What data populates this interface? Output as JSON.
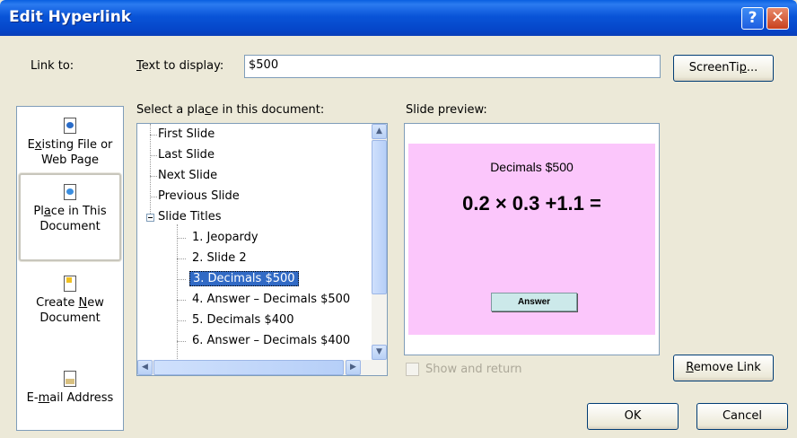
{
  "window": {
    "title": "Edit Hyperlink",
    "help_glyph": "?",
    "close_glyph": "✕"
  },
  "link_to_label": "Link to:",
  "text_to_display": {
    "label_u": "T",
    "label_rest": "ext to display:",
    "value": "$500"
  },
  "screentip_button": {
    "pre": "ScreenTi",
    "u": "p",
    "post": "..."
  },
  "sidebar": {
    "items": [
      {
        "line1_u": "x",
        "line1_pre": "E",
        "line1_post": "isting File or",
        "line2": "Web Page",
        "icon": "existing-file-icon"
      },
      {
        "line1_pre": "Pl",
        "line1_u": "a",
        "line1_post": "ce in This",
        "line2": "Document",
        "icon": "place-in-document-icon",
        "selected": true
      },
      {
        "line1_pre": "Create ",
        "line1_u": "N",
        "line1_post": "ew",
        "line2": "Document",
        "icon": "new-document-icon"
      },
      {
        "line1_pre": "E-",
        "line1_u": "m",
        "line1_post": "ail Address",
        "line2": "",
        "icon": "email-icon"
      }
    ]
  },
  "place_label": {
    "pre": "Select a pla",
    "u": "c",
    "post": "e in this document:"
  },
  "tree": {
    "items": [
      {
        "label": "First Slide",
        "level": 0
      },
      {
        "label": "Last Slide",
        "level": 0
      },
      {
        "label": "Next Slide",
        "level": 0
      },
      {
        "label": "Previous Slide",
        "level": 0
      },
      {
        "label": "Slide Titles",
        "level": 0,
        "expanded": true
      },
      {
        "label": "1. Jeopardy",
        "level": 1
      },
      {
        "label": "2. Slide 2",
        "level": 1
      },
      {
        "label": "3. Decimals $500",
        "level": 1,
        "selected": true
      },
      {
        "label": "4. Answer – Decimals $500",
        "level": 1
      },
      {
        "label": "5. Decimals $400",
        "level": 1
      },
      {
        "label": "6. Answer – Decimals $400",
        "level": 1
      }
    ]
  },
  "scroll_glyphs": {
    "up": "▲",
    "down": "▼",
    "left": "◀",
    "right": "▶"
  },
  "preview": {
    "label": "Slide preview:",
    "slide_title": "Decimals $500",
    "equation": "0.2 × 0.3 +1.1 =",
    "answer_button": "Answer",
    "background_color": "#fbc6fb"
  },
  "show_and_return": {
    "label": "Show and return",
    "checked": false,
    "enabled": false
  },
  "remove_link_button": {
    "u": "R",
    "post": "emove Link"
  },
  "ok_button": "OK",
  "cancel_button": "Cancel"
}
